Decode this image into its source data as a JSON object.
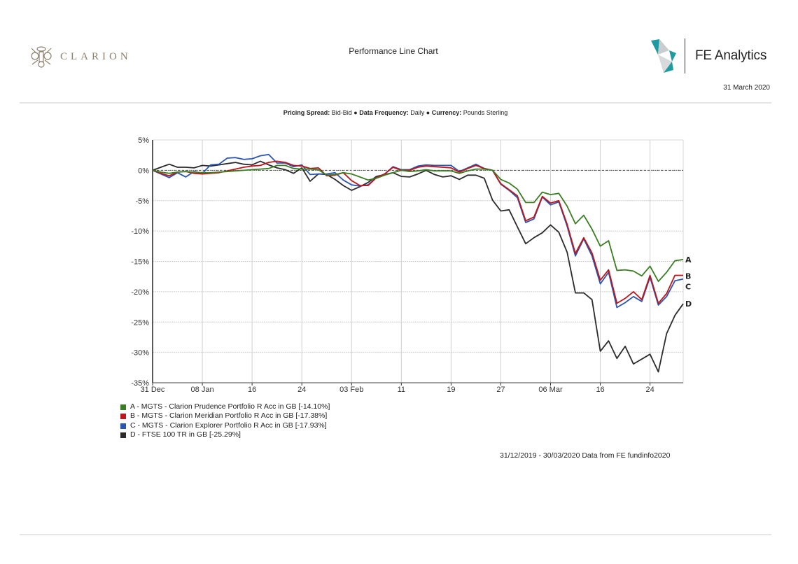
{
  "header": {
    "brand_left": "CLARION",
    "title": "Performance Line Chart",
    "brand_right": "FE Analytics",
    "date": "31 March 2020"
  },
  "subtitle": {
    "items": [
      {
        "label": "Pricing Spread:",
        "value": "Bid-Bid"
      },
      {
        "label": "Data Frequency:",
        "value": "Daily"
      },
      {
        "label": "Currency:",
        "value": "Pounds Sterling"
      }
    ],
    "separator": "●"
  },
  "footnote": "31/12/2019 - 30/03/2020 Data from FE fundinfo2020",
  "colors": {
    "A": "#3a7d23",
    "B": "#c0141c",
    "C": "#2a55b0",
    "D": "#2b2b2b",
    "grid": "#cfcfcf",
    "zero_line": "#444444"
  },
  "chart_data": {
    "type": "line",
    "title": "Performance Line Chart",
    "xlabel": "",
    "ylabel": "",
    "ylim": [
      -35,
      5
    ],
    "yticks": [
      5,
      0,
      -5,
      -10,
      -15,
      -20,
      -25,
      -30,
      -35
    ],
    "ytick_labels": [
      "5%",
      "0%",
      "-5%",
      "-10%",
      "-15%",
      "-20%",
      "-25%",
      "-30%",
      "-35%"
    ],
    "x_range": [
      "31/12/2019",
      "30/03/2020"
    ],
    "xtick_labels": [
      "31 Dec",
      "08 Jan",
      "16",
      "24",
      "03 Feb",
      "11",
      "19",
      "27",
      "06 Mar",
      "16",
      "24"
    ],
    "xtick_index": [
      0,
      6,
      12,
      18,
      24,
      30,
      36,
      42,
      48,
      54,
      60
    ],
    "x_points": 65,
    "grid": true,
    "legend_position": "bottom-left",
    "legend": [
      {
        "key": "A",
        "text": "A - MGTS - Clarion Prudence Portfolio R Acc in GB [-14.10%]"
      },
      {
        "key": "B",
        "text": "B - MGTS - Clarion Meridian Portfolio R Acc in GB [-17.38%]"
      },
      {
        "key": "C",
        "text": "C - MGTS - Clarion Explorer Portfolio R Acc in GB [-17.93%]"
      },
      {
        "key": "D",
        "text": "D - FTSE 100 TR in GB [-25.29%]"
      }
    ],
    "series": [
      {
        "key": "A",
        "name": "MGTS - Clarion Prudence Portfolio R Acc in GB",
        "final": -14.1,
        "values": [
          0,
          -0.3,
          -0.5,
          -0.3,
          -0.2,
          -0.3,
          -0.4,
          -0.4,
          -0.3,
          -0.2,
          -0.1,
          0,
          0.1,
          0.2,
          0.3,
          0.8,
          0.8,
          0.3,
          0.2,
          0.2,
          0.1,
          -0.8,
          -0.7,
          -0.4,
          -0.6,
          -1.1,
          -1.6,
          -1.3,
          -0.8,
          -0.4,
          0,
          -0.2,
          -0.1,
          0.1,
          -0.1,
          -0.1,
          -0.1,
          -0.5,
          -0.1,
          0.2,
          0.2,
          0,
          -1.5,
          -2.1,
          -3.1,
          -5.3,
          -5.3,
          -3.6,
          -4.0,
          -3.8,
          -5.9,
          -8.8,
          -7.4,
          -9.7,
          -12.5,
          -11.6,
          -16.5,
          -16.4,
          -16.6,
          -17.4,
          -15.8,
          -18.3,
          -16.8,
          -14.9,
          -14.7,
          -14.0,
          -14.1
        ]
      },
      {
        "key": "B",
        "name": "MGTS - Clarion Meridian Portfolio R Acc in GB",
        "final": -17.38,
        "values": [
          0,
          -0.5,
          -0.9,
          -0.3,
          -0.2,
          -0.5,
          -0.6,
          -0.5,
          -0.4,
          -0.1,
          0.2,
          0.5,
          0.7,
          0.8,
          1.3,
          1.5,
          1.3,
          0.8,
          0.7,
          0.3,
          0.4,
          -0.9,
          -0.8,
          -0.4,
          -1.7,
          -2.5,
          -2.5,
          -1.2,
          -0.6,
          0.5,
          0,
          0,
          0.5,
          0.7,
          0.6,
          0.5,
          0.4,
          -0.3,
          0.3,
          0.8,
          0.3,
          0,
          -2.2,
          -3.2,
          -4.2,
          -8.3,
          -7.7,
          -4.3,
          -5.4,
          -5.0,
          -8.9,
          -13.7,
          -11.1,
          -13.6,
          -18.1,
          -16.4,
          -21.9,
          -21.1,
          -20.0,
          -21.3,
          -17.3,
          -21.9,
          -20.3,
          -17.3,
          -17.3,
          -16.4,
          -17.4
        ]
      },
      {
        "key": "C",
        "name": "MGTS - Clarion Explorer Portfolio R Acc in GB",
        "final": -17.93,
        "values": [
          0,
          -0.6,
          -1.2,
          -0.4,
          -1.1,
          -0.2,
          -0.5,
          0.9,
          1.0,
          2.0,
          2.1,
          1.8,
          1.9,
          2.4,
          2.6,
          1.2,
          1.2,
          0.6,
          0.9,
          -0.7,
          -0.6,
          -0.6,
          -0.4,
          -1.6,
          -2.4,
          -2.6,
          -2.4,
          -1.2,
          -0.6,
          0.6,
          0.1,
          0.1,
          0.7,
          0.9,
          0.8,
          0.8,
          0.8,
          -0.2,
          0.4,
          1.0,
          0.3,
          0,
          -2.3,
          -3.3,
          -4.5,
          -8.6,
          -8.0,
          -4.4,
          -5.7,
          -5.2,
          -9.2,
          -14.1,
          -11.3,
          -14.1,
          -18.7,
          -16.8,
          -22.6,
          -21.8,
          -20.8,
          -21.6,
          -17.6,
          -22.2,
          -20.8,
          -18.2,
          -17.9,
          -17.0,
          -17.9
        ]
      },
      {
        "key": "D",
        "name": "FTSE 100 TR in GB",
        "final": -25.29,
        "values": [
          0,
          0.5,
          1.0,
          0.5,
          0.5,
          0.4,
          0.8,
          0.7,
          0.9,
          1.1,
          1.3,
          1.0,
          0.9,
          1.5,
          0.9,
          0.4,
          0.1,
          -0.5,
          0.4,
          -1.8,
          -0.6,
          -0.7,
          -1.5,
          -2.5,
          -3.3,
          -2.7,
          -2.0,
          -1.0,
          -0.7,
          -0.4,
          -1.0,
          -1.1,
          -0.6,
          0,
          -0.7,
          -1.1,
          -0.9,
          -1.5,
          -0.8,
          -0.8,
          -1.3,
          -4.9,
          -6.7,
          -6.5,
          -9.3,
          -12.1,
          -11.1,
          -10.3,
          -9.0,
          -10.2,
          -13.5,
          -20.2,
          -20.2,
          -21.3,
          -29.8,
          -28.1,
          -31.0,
          -29.0,
          -31.9,
          -31.1,
          -30.3,
          -33.2,
          -26.9,
          -23.9,
          -22.0,
          -26.0,
          -25.3
        ]
      }
    ]
  }
}
